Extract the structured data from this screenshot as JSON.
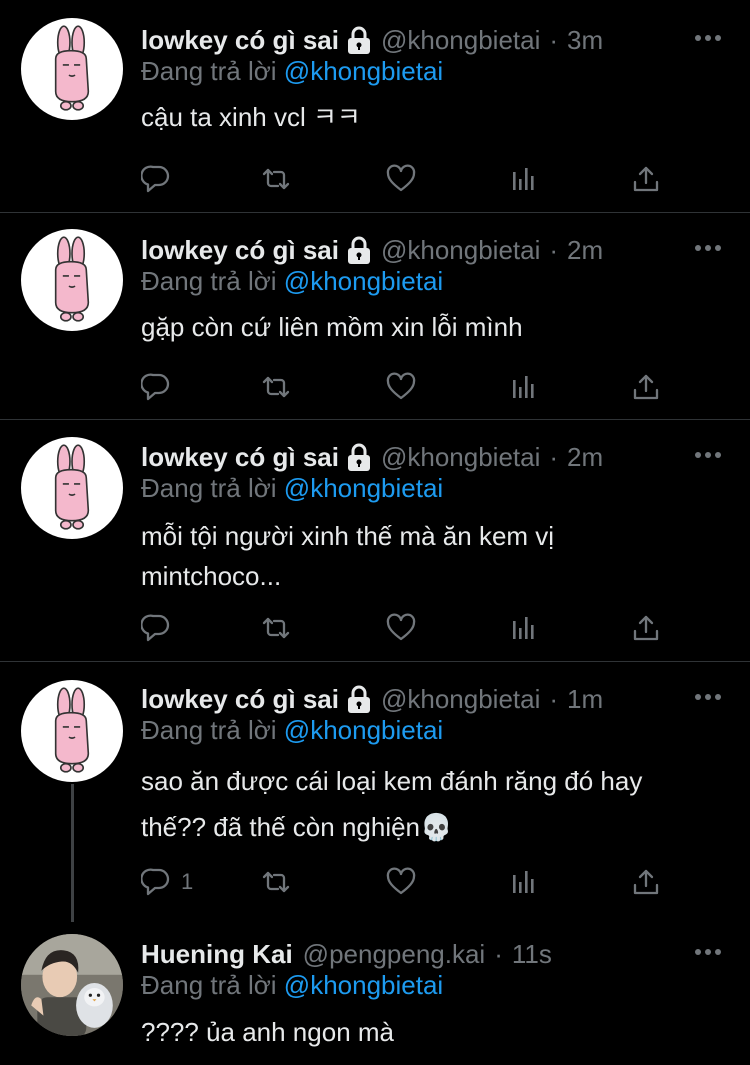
{
  "tweets": [
    {
      "name": "lowkey có gì sai",
      "handle": "@khongbietai",
      "time": "3m",
      "reply_prefix": "Đang trả lời",
      "reply_to": "@khongbietai",
      "text": "cậu ta xinh vcl ㅋㅋ",
      "reply_count": ""
    },
    {
      "name": "lowkey có gì sai",
      "handle": "@khongbietai",
      "time": "2m",
      "reply_prefix": "Đang trả lời",
      "reply_to": "@khongbietai",
      "text": "gặp còn cứ liên mồm xin lỗi mình",
      "reply_count": ""
    },
    {
      "name": "lowkey có gì sai",
      "handle": "@khongbietai",
      "time": "2m",
      "reply_prefix": "Đang trả lời",
      "reply_to": "@khongbietai",
      "text": "mỗi tội người xinh thế mà ăn kem vị mintchoco...",
      "reply_count": ""
    },
    {
      "name": "lowkey có gì sai",
      "handle": "@khongbietai",
      "time": "1m",
      "reply_prefix": "Đang trả lời",
      "reply_to": "@khongbietai",
      "text": "sao ăn được cái loại kem đánh răng đó hay thế?? đã thế còn nghiện💀",
      "reply_count": "1"
    },
    {
      "name": "Huening Kai",
      "handle": "@pengpeng.kai",
      "time": "11s",
      "reply_prefix": "Đang trả lời",
      "reply_to": "@khongbietai",
      "text": "???? ủa anh ngon mà",
      "reply_count": ""
    }
  ],
  "separator": "·",
  "icons": {
    "more": "more-horizontal-icon",
    "lock": "lock-icon",
    "reply": "reply-icon",
    "retweet": "retweet-icon",
    "like": "heart-icon",
    "views": "analytics-icon",
    "share": "share-icon"
  },
  "colors": {
    "background": "#000000",
    "text": "#e7e9ea",
    "secondary": "#71767b",
    "accent": "#1d9bf0",
    "divider": "#2f3336"
  }
}
